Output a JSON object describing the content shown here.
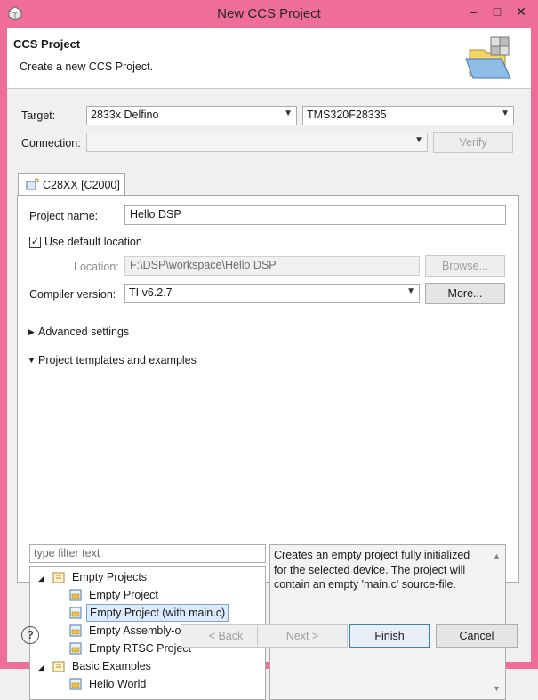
{
  "window": {
    "title": "New CCS Project",
    "minimize_glyph": "–",
    "maximize_glyph": "□",
    "close_glyph": "✕"
  },
  "header": {
    "title": "CCS Project",
    "subtitle": "Create a new CCS Project."
  },
  "target": {
    "label": "Target:",
    "family": "2833x Delfino",
    "device": "TMS320F28335"
  },
  "connection": {
    "label": "Connection:",
    "value": "",
    "verify_label": "Verify"
  },
  "tab": {
    "label": "C28XX [C2000]"
  },
  "project": {
    "name_label": "Project name:",
    "name_value": "Hello DSP",
    "use_default_label": "Use default location",
    "use_default_checked": true,
    "location_label": "Location:",
    "location_value": "F:\\DSP\\workspace\\Hello DSP",
    "browse_label": "Browse...",
    "compiler_label": "Compiler version:",
    "compiler_value": "TI v6.2.7",
    "more_label": "More..."
  },
  "sections": {
    "advanced": "Advanced settings",
    "templates": "Project templates and examples"
  },
  "templates": {
    "filter_placeholder": "type filter text",
    "tree": [
      {
        "label": "Empty Projects",
        "kind": "group",
        "expanded": true
      },
      {
        "label": "Empty Project",
        "kind": "item"
      },
      {
        "label": "Empty Project (with main.c)",
        "kind": "item",
        "selected": true
      },
      {
        "label": "Empty Assembly-only Project",
        "kind": "item"
      },
      {
        "label": "Empty RTSC Project",
        "kind": "item"
      },
      {
        "label": "Basic Examples",
        "kind": "group",
        "expanded": true
      },
      {
        "label": "Hello World",
        "kind": "item"
      }
    ],
    "description": "Creates an empty project fully initialized for the selected device. The project will contain an empty 'main.c' source-file."
  },
  "footer": {
    "help_glyph": "?",
    "back_label": "< Back",
    "next_label": "Next >",
    "finish_label": "Finish",
    "cancel_label": "Cancel"
  },
  "colors": {
    "titlebar": "#ef6e98",
    "selection": "#dcebfc"
  }
}
